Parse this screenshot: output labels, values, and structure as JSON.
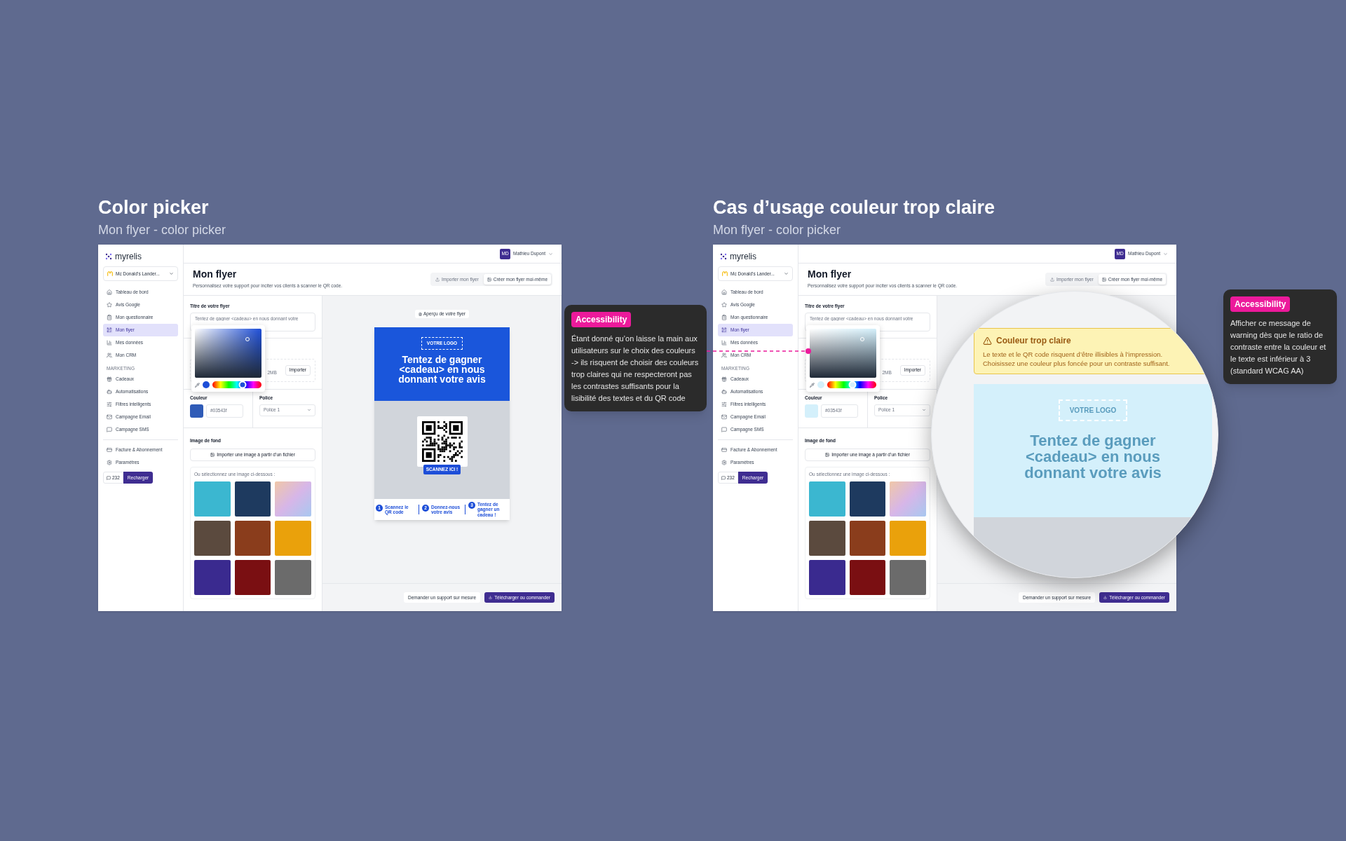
{
  "boards": [
    {
      "title": "Color picker",
      "subtitle": "Mon flyer - color picker",
      "app": {
        "logo": "myrelis",
        "account": "Mc Donald’s Lander...",
        "nav": [
          {
            "label": "Tableau de bord",
            "selected": false
          },
          {
            "label": "Avis Google",
            "selected": false
          },
          {
            "label": "Mon questionnaire",
            "selected": false
          },
          {
            "label": "Mon flyer",
            "selected": true
          },
          {
            "label": "Mes données",
            "selected": false
          },
          {
            "label": "Mon CRM",
            "selected": false
          }
        ],
        "section_label": "MARKETING",
        "marketing": [
          {
            "label": "Cadeaux",
            "selected": false
          },
          {
            "label": "Automatisations",
            "selected": false
          },
          {
            "label": "Filtres intelligents",
            "selected": false
          },
          {
            "label": "Campagne Email",
            "selected": false
          },
          {
            "label": "Campagne SMS",
            "selected": false
          }
        ],
        "bottom": [
          {
            "label": "Facture & Abonnement",
            "selected": false
          },
          {
            "label": "Paramètres",
            "selected": false
          }
        ],
        "credits": {
          "count": "232",
          "button": "Recharger"
        },
        "user": {
          "initials": "MD",
          "name": "Mathieu Dupont"
        },
        "page_title": "Mon flyer",
        "description": "Personnalisez votre support pour inciter vos clients à scanner le QR code.",
        "mode_buttons": [
          {
            "label": "Importer mon flyer",
            "selected": false
          },
          {
            "label": "Créer mon flyer moi-même",
            "selected": true
          }
        ],
        "title_field": {
          "label": "Titre de votre flyer",
          "placeholder": "Tentez de gagner <cadeau> en nous donnant votre"
        },
        "upload": {
          "hint": "2MB",
          "button": "Importer"
        },
        "picker": {
          "color": "#1d4ed8",
          "level": 0.62
        },
        "color_field": {
          "label": "Couleur",
          "color": "#2f5bb7",
          "value": "#03543f"
        },
        "font_field": {
          "label": "Police",
          "value": "Police 1"
        },
        "background": {
          "label": "Image de fond",
          "button": "Importer une image à partir d’un fichier",
          "gallery_label": "Ou sélectionnez une image ci-dessous :"
        },
        "preview": {
          "kind": "flyer",
          "badge": "Aperçu de votre flyer",
          "color": "#1a56db",
          "logo": "VOTRE LOGO",
          "headline": "Tentez de gagner <cadeau> en nous donnant votre avis",
          "scan": "SCANNEZ ICI !",
          "steps": [
            {
              "number": "1",
              "text": "Scannez le QR code"
            },
            {
              "number": "2",
              "text": "Donnez-nous votre avis"
            },
            {
              "number": "3",
              "text": "Tentez de gagner un cadeau !"
            }
          ]
        },
        "footer": [
          {
            "label": "Demander un support sur mesure",
            "kind": "secondary"
          },
          {
            "label": "Télécharger ou commander",
            "kind": "primary"
          }
        ]
      },
      "note": {
        "badge": "Accessibility",
        "text": "Étant donné qu’on laisse la main aux utilisateurs sur le choix des couleurs -> ils risquent de choisir des couleurs trop claires qui ne respecteront pas les contrastes suffisants pour la lisibilité des textes et du QR code"
      }
    },
    {
      "title": "Cas d’usage couleur trop claire",
      "subtitle": "Mon flyer - color picker",
      "app": {
        "logo": "myrelis",
        "account": "Mc Donald’s Lander...",
        "nav": [
          {
            "label": "Tableau de bord",
            "selected": false
          },
          {
            "label": "Avis Google",
            "selected": false
          },
          {
            "label": "Mon questionnaire",
            "selected": false
          },
          {
            "label": "Mon flyer",
            "selected": true
          },
          {
            "label": "Mes données",
            "selected": false
          },
          {
            "label": "Mon CRM",
            "selected": false
          }
        ],
        "section_label": "MARKETING",
        "marketing": [
          {
            "label": "Cadeaux",
            "selected": false
          },
          {
            "label": "Automatisations",
            "selected": false
          },
          {
            "label": "Filtres intelligents",
            "selected": false
          },
          {
            "label": "Campagne Email",
            "selected": false
          },
          {
            "label": "Campagne SMS",
            "selected": false
          }
        ],
        "bottom": [
          {
            "label": "Facture & Abonnement",
            "selected": false
          },
          {
            "label": "Paramètres",
            "selected": false
          }
        ],
        "credits": {
          "count": "232",
          "button": "Recharger"
        },
        "user": {
          "initials": "MD",
          "name": "Mathieu Dupont"
        },
        "page_title": "Mon flyer",
        "description": "Personnalisez votre support pour inciter vos clients à scanner le QR code.",
        "mode_buttons": [
          {
            "label": "Importer mon flyer",
            "selected": false
          },
          {
            "label": "Créer mon flyer moi-même",
            "selected": true
          }
        ],
        "title_field": {
          "label": "Titre de votre flyer",
          "placeholder": "Tentez de gagner <cadeau> en nous donnant votre"
        },
        "upload": {
          "hint": "2MB",
          "button": "Importer"
        },
        "picker": {
          "color": "#d4f0fb",
          "level": 0.52
        },
        "color_field": {
          "label": "Couleur",
          "color": "#d4f0fb",
          "value": "#03543f"
        },
        "font_field": {
          "label": "Police",
          "value": "Police 1"
        },
        "background": {
          "label": "Image de fond",
          "button": "Importer une image à partir d’un fichier",
          "gallery_label": "Ou sélectionnez une image ci-dessous :"
        },
        "preview": {
          "kind": "magnified",
          "warning": {
            "title": "Couleur trop claire",
            "text": "Le texte et le QR code risquent d’être illisibles à l’impression. Choisissez une couleur plus foncée pour un contraste suffisant."
          },
          "color": "#d4f0fb",
          "logo": "VOTRE LOGO",
          "headline": "Tentez de gagner <cadeau> en nous donnant votre avis"
        },
        "footer": [
          {
            "label": "Demander un support sur mesure",
            "kind": "secondary"
          },
          {
            "label": "Télécharger ou commander",
            "kind": "primary"
          }
        ]
      },
      "note": {
        "badge": "Accessibility",
        "text": "Afficher ce message de warning dès que le ratio de contraste entre la couleur et le texte est inférieur à 3 (standard WCAG AA)"
      }
    }
  ]
}
